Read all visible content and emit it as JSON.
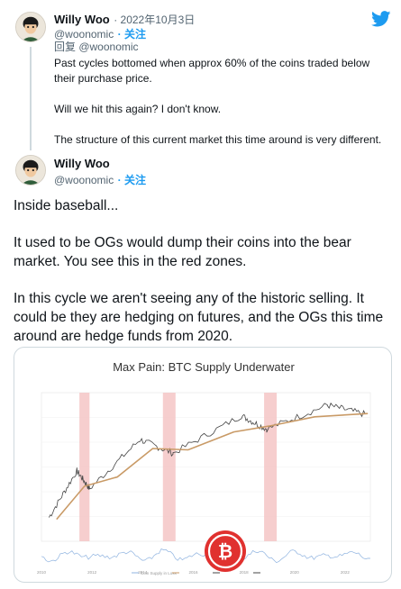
{
  "first_tweet": {
    "author_name": "Willy Woo",
    "date": "· 2022年10月3日",
    "handle": "@woonomic",
    "follow_label": "· 关注",
    "reply_to": "回复 @woonomic",
    "quoted_lines": [
      "Past cycles bottomed when approx 60% of the coins traded below their purchase price.",
      "Will we hit this again? I don't know.",
      "The structure of this current market this time around is very different."
    ]
  },
  "second_tweet": {
    "author_name": "Willy Woo",
    "handle": "@woonomic",
    "follow_label": "· 关注",
    "paragraphs": [
      "Inside baseball...",
      "It used to be OGs would dump their coins into the bear market. You see this in the red zones.",
      "In this cycle we aren't seeing any of the historic selling. It could be they are hedging on futures, and the OGs this time around are hedge funds from 2020."
    ]
  },
  "icons": {
    "twitter_logo": "twitter-bird-icon",
    "watermark": "bitcoin-watermark-icon"
  },
  "colors": {
    "twitter_blue": "#1d9bf0",
    "price_line": "#444444",
    "cost_basis_line": "#c99a66",
    "red_zone": "#f4c6c6",
    "oscillator": "#8fb3e0",
    "watermark": "#e0312f"
  },
  "chart_data": {
    "type": "line",
    "title": "Max Pain: BTC Supply Underwater",
    "subtitle": "",
    "x": [
      "2010",
      "2012",
      "2014",
      "2016",
      "2018",
      "2020",
      "2022"
    ],
    "xlim": [
      "2010",
      "2023"
    ],
    "log_scale": true,
    "grid": true,
    "legend_position": "bottom",
    "legend": [
      "Coin Supply in Loss",
      "",
      "",
      ""
    ],
    "series": [
      {
        "name": "",
        "kind": "price",
        "values": [
          0.1,
          10,
          600,
          400,
          15000,
          7000,
          60000,
          20000
        ]
      },
      {
        "name": "",
        "kind": "realized-price",
        "values": [
          0.1,
          5,
          300,
          350,
          6000,
          5000,
          20000,
          21000
        ]
      },
      {
        "name": "Coin Supply in Loss",
        "kind": "oscillator",
        "values": []
      }
    ],
    "red_zones": [
      {
        "from": "2011.5",
        "to": "2011.9"
      },
      {
        "from": "2014.8",
        "to": "2015.3"
      },
      {
        "from": "2018.8",
        "to": "2019.3"
      }
    ]
  }
}
